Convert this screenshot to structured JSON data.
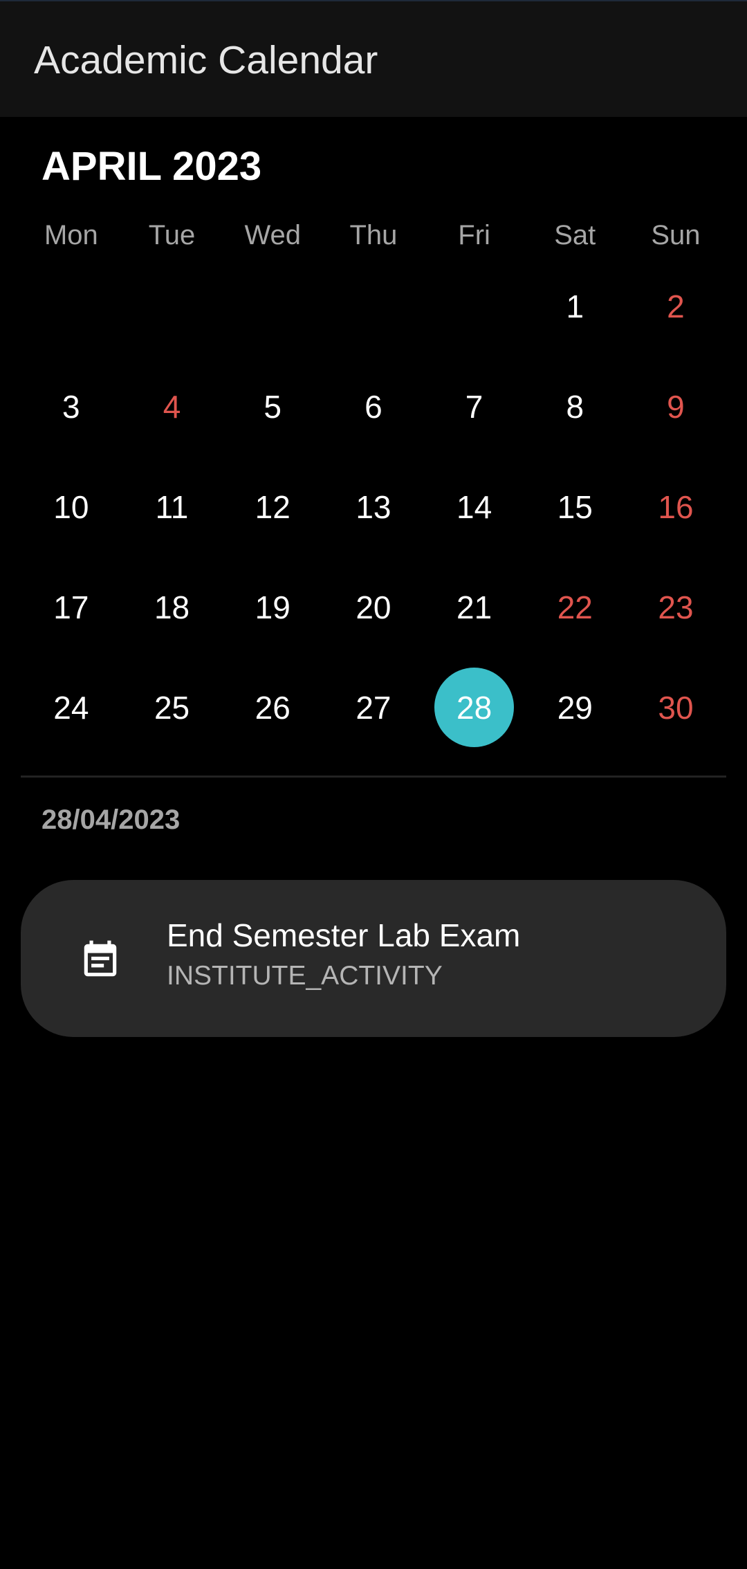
{
  "app_bar": {
    "title": "Academic Calendar"
  },
  "calendar": {
    "month_label": "APRIL 2023",
    "weekdays": [
      "Mon",
      "Tue",
      "Wed",
      "Thu",
      "Fri",
      "Sat",
      "Sun"
    ],
    "first_weekday_index": 5,
    "days": [
      "1",
      "2",
      "3",
      "4",
      "5",
      "6",
      "7",
      "8",
      "9",
      "10",
      "11",
      "12",
      "13",
      "14",
      "15",
      "16",
      "17",
      "18",
      "19",
      "20",
      "21",
      "22",
      "23",
      "24",
      "25",
      "26",
      "27",
      "28",
      "29",
      "30"
    ],
    "holidays": [
      "2",
      "4",
      "9",
      "16",
      "22",
      "23",
      "30"
    ],
    "selected_day": "28",
    "colors": {
      "holiday": "#e0554e",
      "selected_bg": "#3bbfc9",
      "weekday_text": "#a6a6a6"
    }
  },
  "selection": {
    "date_label": "28/04/2023"
  },
  "events": [
    {
      "title": "End Semester Lab Exam",
      "type": "INSTITUTE_ACTIVITY",
      "icon": "event-note-icon"
    }
  ]
}
